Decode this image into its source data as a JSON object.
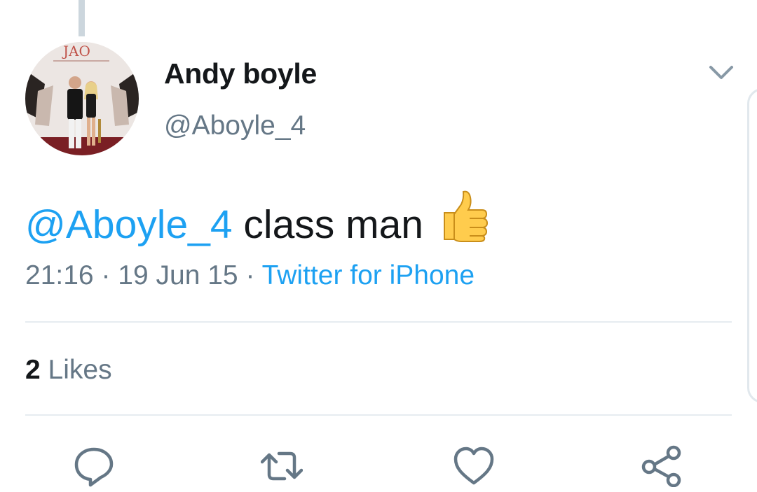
{
  "tweet": {
    "display_name": "Andy boyle",
    "handle": "@Aboyle_4",
    "mention": "@Aboyle_4",
    "body": "class man",
    "emoji": "thumbs-up-emoji",
    "time": "21:16",
    "sep1": "·",
    "date": "19 Jun 15",
    "sep2": "·",
    "source": "Twitter for iPhone"
  },
  "stats": {
    "likes_count": "2",
    "likes_label": "Likes"
  },
  "actions": {
    "reply_icon": "speech-bubble-icon",
    "retweet_icon": "retweet-arrows-icon",
    "like_icon": "heart-outline-icon",
    "share_icon": "share-nodes-icon"
  },
  "colors": {
    "link": "#1da1f2",
    "text": "#14171a",
    "secondary": "#657786",
    "icon": "#657786",
    "divider": "#e6ecf0"
  }
}
